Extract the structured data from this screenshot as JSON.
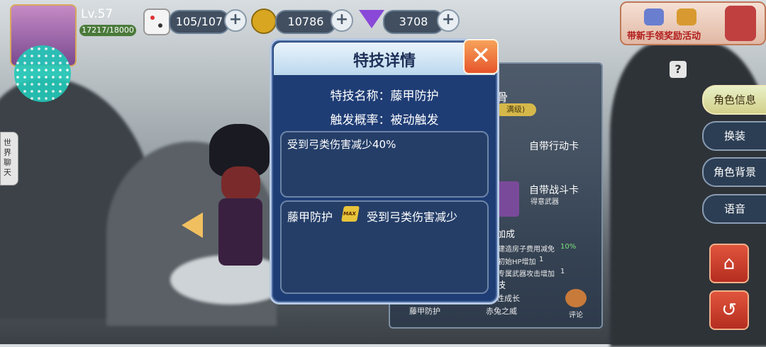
{
  "player": {
    "level": "Lv.57",
    "exp": "17217/18000"
  },
  "resources": {
    "dice": "105/107",
    "coins": "10786",
    "gems": "3708"
  },
  "event_banner": "带新手领奖励活动",
  "help_label": "?",
  "side_chat_label": "世界聊天",
  "dialog": {
    "title": "特技详情",
    "name_line": "特技名称：藤甲防护",
    "trigger_line": "触发概率：被动触发",
    "effect_text": "受到弓类伤害减少40%",
    "detail_name": "藤甲防护",
    "detail_badge": "MAX",
    "detail_text": "受到弓类伤害减少"
  },
  "panel": {
    "name_partial": "骨",
    "tag_partial": "满级)",
    "card1": "自带行动卡",
    "card2": "自带战斗卡",
    "card2_sub": "得意武器",
    "bonus_header": "加成",
    "bonus_rows": [
      {
        "text": "建造房子费用减免",
        "value": "10%"
      },
      {
        "text": "初始HP增加",
        "value": "1"
      },
      {
        "text": "专属武器攻击增加",
        "value": "1"
      }
    ],
    "skill_header": "技",
    "skills": [
      "性成长",
      "藤甲防护",
      "赤兔之威"
    ],
    "comment_label": "评论"
  },
  "side_menu": [
    "角色信息",
    "换装",
    "角色背景",
    "语音"
  ],
  "colors": {
    "dialog_bg": "#1f3d75",
    "accent_yellow": "#d2d08a",
    "close_red": "#e6552b"
  }
}
